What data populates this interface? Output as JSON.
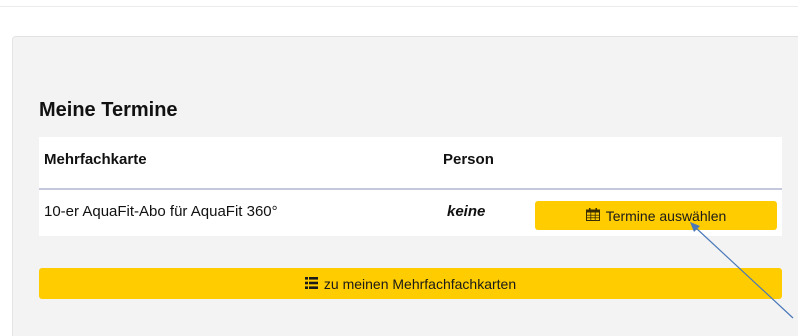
{
  "section": {
    "title": "Meine Termine"
  },
  "table": {
    "headers": {
      "card": "Mehrfachkarte",
      "person": "Person"
    },
    "rows": [
      {
        "card": "10-er AquaFit-Abo für AquaFit 360°",
        "person": "keine",
        "action_label": "Termine auswählen"
      }
    ]
  },
  "buttons": {
    "my_cards_label": "zu meinen Mehrfachfachkarten"
  },
  "icons": {
    "select_dates": "calendar-icon",
    "my_cards": "list-icon",
    "annotation": "arrow-annotation"
  },
  "colors": {
    "button": "#ffcc00",
    "card_background": "#f3f3f3",
    "header_divider": "#c3c8dc",
    "annotation_arrow": "#4a78b8"
  }
}
